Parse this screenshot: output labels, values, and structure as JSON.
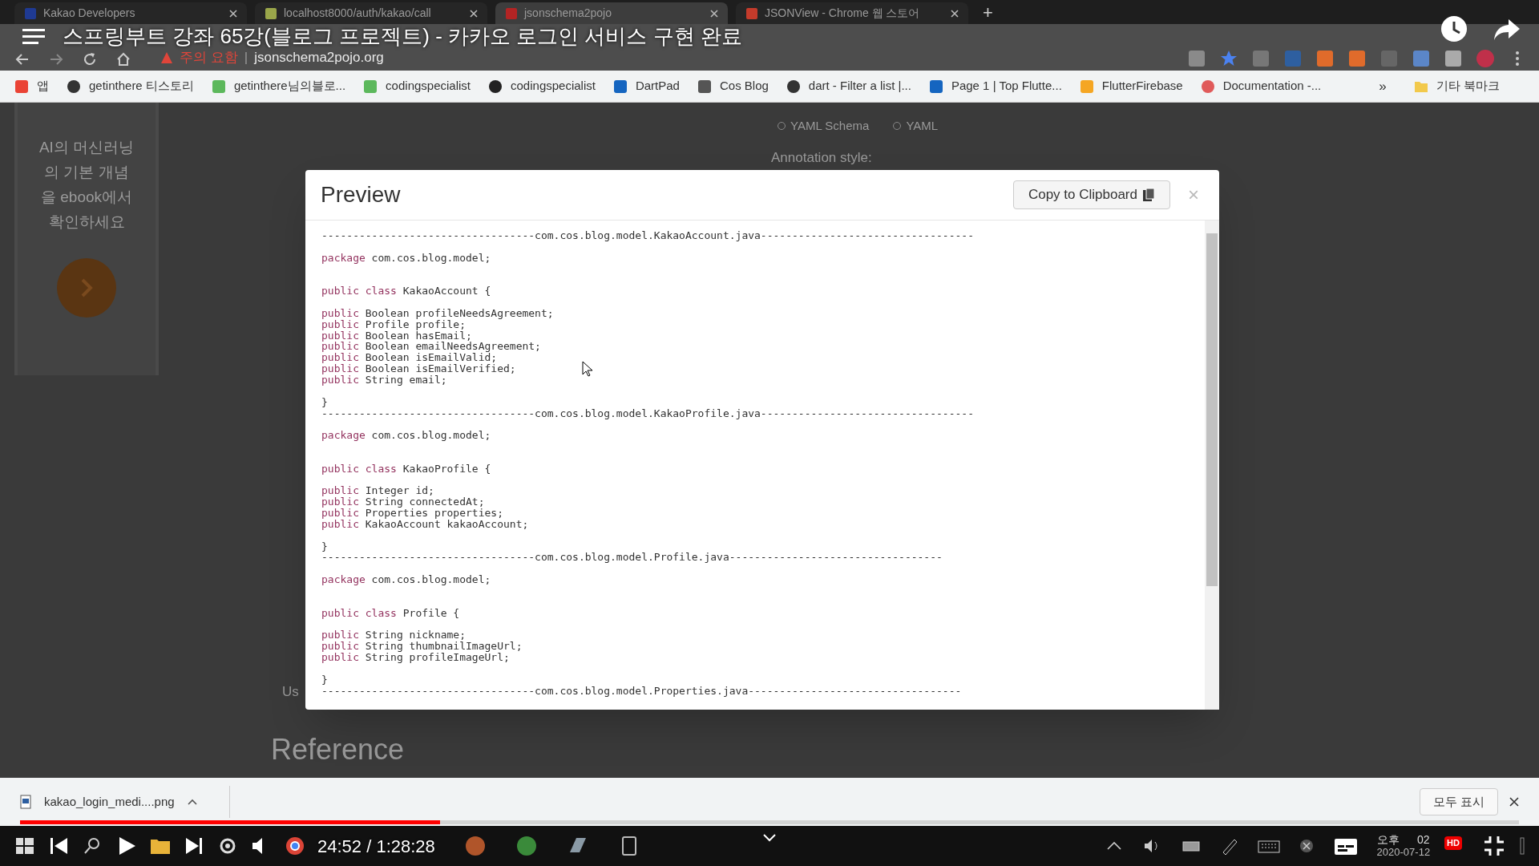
{
  "video": {
    "title": "스프링부트 강좌 65강(블로그 프로젝트) - 카카오 로그인 서비스 구현 완료",
    "time": "24:52 / 1:28:28",
    "level": 0.28
  },
  "browser": {
    "tabs": [
      {
        "label": "Kakao Developers",
        "selected": false
      },
      {
        "label": "localhost8000/auth/kakao/call",
        "selected": false
      },
      {
        "label": "jsonschema2pojo",
        "selected": true
      },
      {
        "label": "JSONView - Chrome 웹 스토어",
        "selected": false
      }
    ],
    "new_tab": "+",
    "security": "주의 요함",
    "url_divider": "|",
    "url": "jsonschema2pojo.org",
    "bookmarks": [
      "앱",
      "getinthere 티스토리",
      "getinthere님의블로...",
      "codingspecialist",
      "codingspecialist",
      "DartPad",
      "Cos Blog",
      "dart - Filter a list |...",
      "Page 1 | Top Flutte...",
      "FlutterFirebase",
      "Documentation -..."
    ],
    "bookmarks_more": "»",
    "other_bookmarks": "기타 북마크"
  },
  "page": {
    "ad_text": "AI의 머신러닝의 기본 개념을 ebook에서 확인하세요",
    "options": [
      "YAML Schema",
      "YAML"
    ],
    "annotation_label": "Annotation style:",
    "heading": "Reference",
    "cut_text": "Us"
  },
  "modal": {
    "title": "Preview",
    "copy_button": "Copy to Clipboard",
    "close": "×",
    "lines": [
      {
        "kind": "separator",
        "text": "----------------------------------com.cos.blog.model.KakaoAccount.java----------------------------------"
      },
      {
        "kind": "blank"
      },
      {
        "kind": "code",
        "keyword": "package",
        "text": " com.cos.blog.model;"
      },
      {
        "kind": "blank"
      },
      {
        "kind": "blank"
      },
      {
        "kind": "code",
        "keyword": "public class",
        "text": " KakaoAccount {"
      },
      {
        "kind": "blank"
      },
      {
        "kind": "code",
        "keyword": "public",
        "text": " Boolean profileNeedsAgreement;"
      },
      {
        "kind": "code",
        "keyword": "public",
        "text": " Profile profile;"
      },
      {
        "kind": "code",
        "keyword": "public",
        "text": " Boolean hasEmail;"
      },
      {
        "kind": "code",
        "keyword": "public",
        "text": " Boolean emailNeedsAgreement;"
      },
      {
        "kind": "code",
        "keyword": "public",
        "text": " Boolean isEmailValid;"
      },
      {
        "kind": "code",
        "keyword": "public",
        "text": " Boolean isEmailVerified;"
      },
      {
        "kind": "code",
        "keyword": "public",
        "text": " String email;"
      },
      {
        "kind": "blank"
      },
      {
        "kind": "code",
        "text": "}"
      },
      {
        "kind": "separator",
        "text": "----------------------------------com.cos.blog.model.KakaoProfile.java----------------------------------"
      },
      {
        "kind": "blank"
      },
      {
        "kind": "code",
        "keyword": "package",
        "text": " com.cos.blog.model;"
      },
      {
        "kind": "blank"
      },
      {
        "kind": "blank"
      },
      {
        "kind": "code",
        "keyword": "public class",
        "text": " KakaoProfile {"
      },
      {
        "kind": "blank"
      },
      {
        "kind": "code",
        "keyword": "public",
        "text": " Integer id;"
      },
      {
        "kind": "code",
        "keyword": "public",
        "text": " String connectedAt;"
      },
      {
        "kind": "code",
        "keyword": "public",
        "text": " Properties properties;"
      },
      {
        "kind": "code",
        "keyword": "public",
        "text": " KakaoAccount kakaoAccount;"
      },
      {
        "kind": "blank"
      },
      {
        "kind": "code",
        "text": "}"
      },
      {
        "kind": "separator",
        "text": "----------------------------------com.cos.blog.model.Profile.java----------------------------------"
      },
      {
        "kind": "blank"
      },
      {
        "kind": "code",
        "keyword": "package",
        "text": " com.cos.blog.model;"
      },
      {
        "kind": "blank"
      },
      {
        "kind": "blank"
      },
      {
        "kind": "code",
        "keyword": "public class",
        "text": " Profile {"
      },
      {
        "kind": "blank"
      },
      {
        "kind": "code",
        "keyword": "public",
        "text": " String nickname;"
      },
      {
        "kind": "code",
        "keyword": "public",
        "text": " String thumbnailImageUrl;"
      },
      {
        "kind": "code",
        "keyword": "public",
        "text": " String profileImageUrl;"
      },
      {
        "kind": "blank"
      },
      {
        "kind": "code",
        "text": "}"
      },
      {
        "kind": "separator",
        "text": "----------------------------------com.cos.blog.model.Properties.java----------------------------------"
      }
    ]
  },
  "downloads": {
    "file": "kakao_login_medi....png",
    "show_all": "모두 표시"
  },
  "clock": {
    "period": "오후",
    "time": "02",
    "date": "2020-07-12",
    "badge": "HD"
  }
}
